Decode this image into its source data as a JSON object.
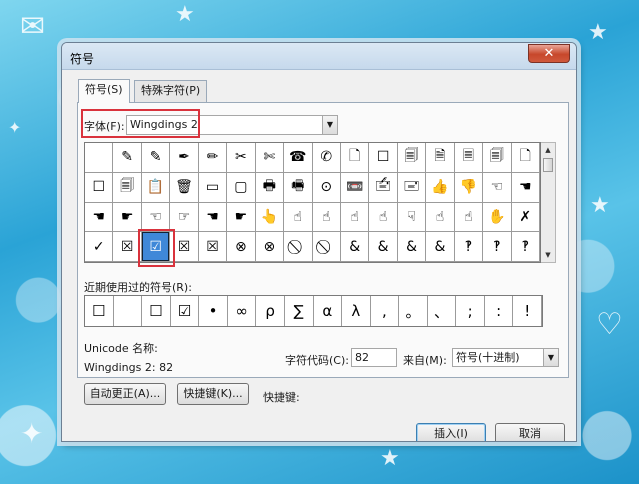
{
  "dialog": {
    "title": "符号",
    "close_glyph": "✕"
  },
  "tabs": [
    {
      "label": "符号(S)"
    },
    {
      "label": "特殊字符(P)"
    }
  ],
  "font": {
    "label": "字体(F):",
    "value": "Wingdings 2"
  },
  "symbols": [
    [
      "",
      "✎",
      "✎",
      "✒",
      "✏",
      "✂",
      "✄",
      "☎",
      "✆",
      "🗋",
      "☐",
      "🗐",
      "🗎",
      "🗏",
      "🗐",
      "🗋"
    ],
    [
      "☐",
      "🗐",
      "📋",
      "🗑",
      "▭",
      "▢",
      "🖶",
      "🖷",
      "⊙",
      "📼",
      "🖆",
      "🖃",
      "👍",
      "👎",
      "☜",
      "☚"
    ],
    [
      "☚",
      "☛",
      "☜",
      "☞",
      "☚",
      "☛",
      "👆",
      "☝",
      "☝",
      "☝",
      "☝",
      "☟",
      "☝",
      "☝",
      "✋",
      "✗"
    ],
    [
      "✓",
      "☒",
      "☑",
      "☒",
      "☒",
      "⊗",
      "⊗",
      "⃠",
      "⃠",
      "&",
      "&",
      "&",
      "&",
      "‽",
      "‽",
      "‽"
    ]
  ],
  "selected_symbol": "☑",
  "recent": {
    "label": "近期使用过的符号(R):",
    "items": [
      "☐",
      "",
      "☐",
      "☑",
      "•",
      "∞",
      "ρ",
      "∑",
      "α",
      "λ",
      ",",
      "。",
      "、",
      ";",
      ":",
      "!"
    ]
  },
  "unicode": {
    "label": "Unicode 名称:",
    "name": "Wingdings 2: 82"
  },
  "char_code": {
    "label": "字符代码(C):",
    "value": "82"
  },
  "from": {
    "label": "来自(M):",
    "value": "符号(十进制)"
  },
  "buttons": {
    "autocorrect": "自动更正(A)...",
    "shortcut_key": "快捷键(K)...",
    "shortcut_label": "快捷键:",
    "insert": "插入(I)",
    "cancel": "取消"
  },
  "colors": {
    "highlight": "#d9323c",
    "selection": "#3f88d8"
  }
}
